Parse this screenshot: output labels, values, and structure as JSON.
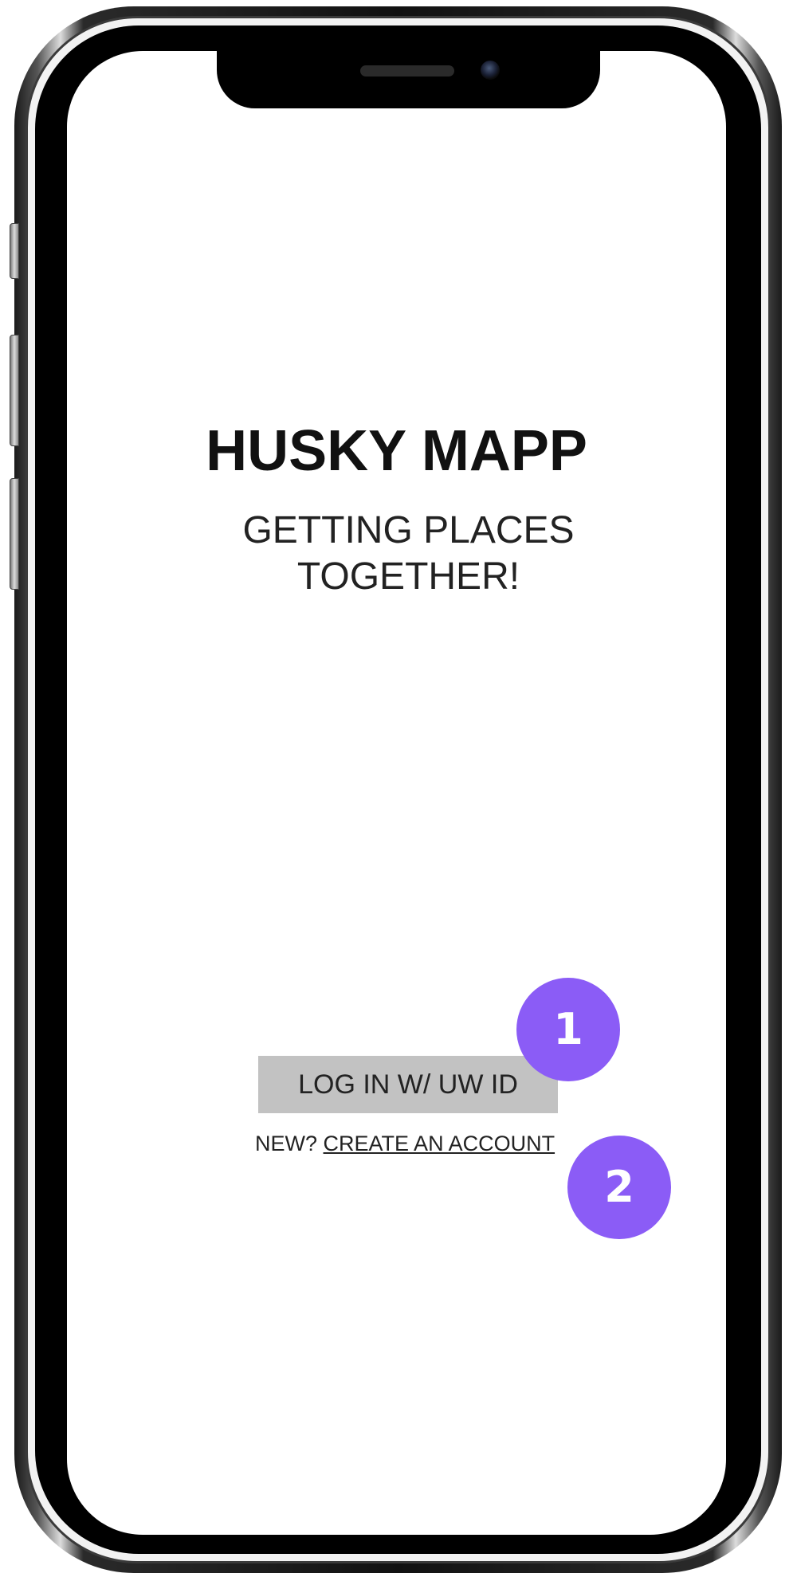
{
  "app": {
    "title": "HUSKY MAPP",
    "tagline_line1": "GETTING PLACES",
    "tagline_line2": "TOGETHER!"
  },
  "login": {
    "button_label": "LOG IN  W/ UW ID"
  },
  "signup": {
    "prompt": "NEW?",
    "link_label": "CREATE AN ACCOUNT"
  },
  "annotations": [
    {
      "label": "1"
    },
    {
      "label": "2"
    }
  ],
  "colors": {
    "badge": "#8b5cf6",
    "button_bg": "#c2c2c2",
    "text": "#111111"
  }
}
